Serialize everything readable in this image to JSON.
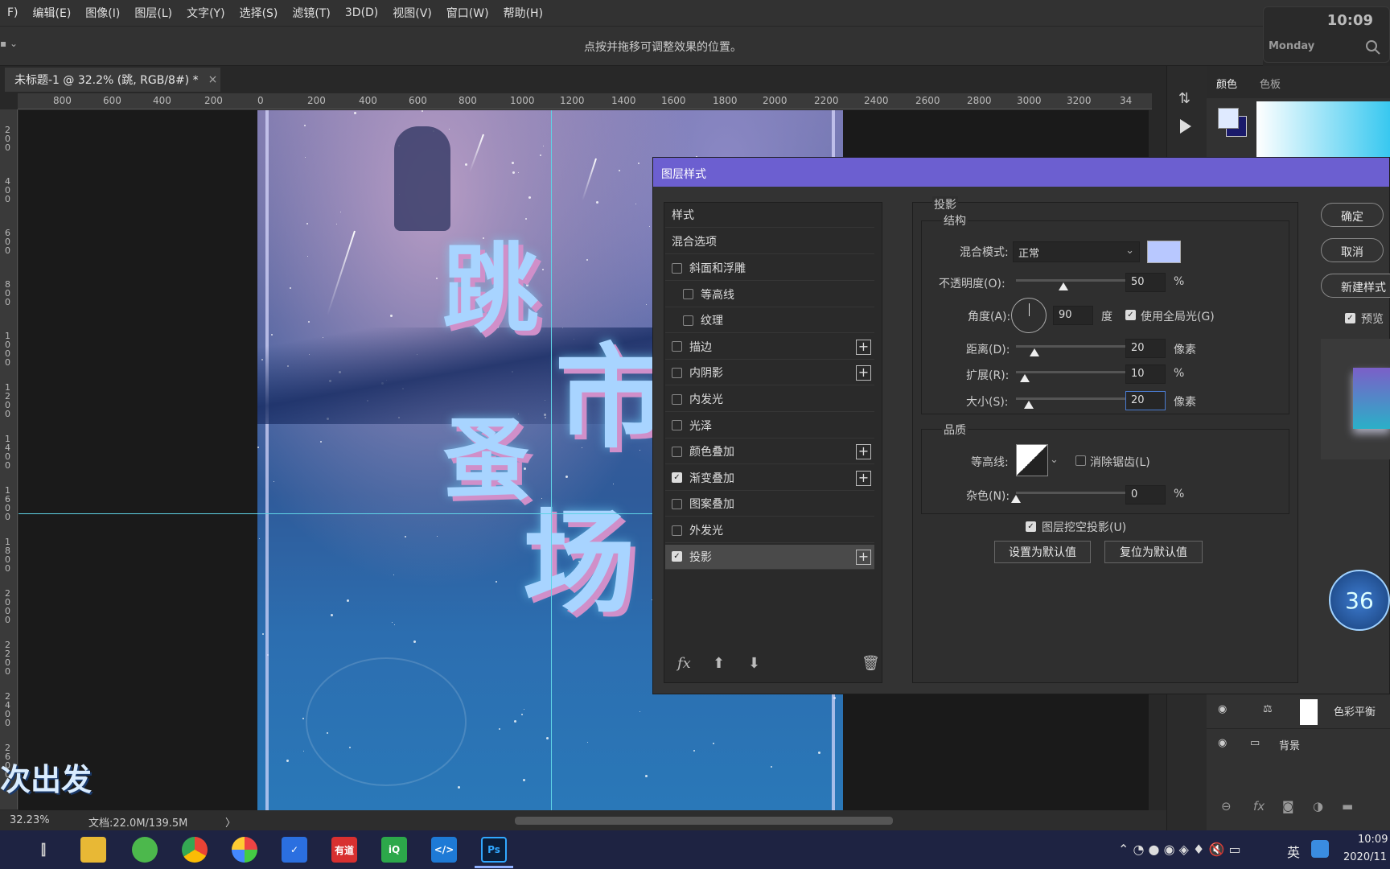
{
  "menu": [
    "F)",
    "编辑(E)",
    "图像(I)",
    "图层(L)",
    "文字(Y)",
    "选择(S)",
    "滤镜(T)",
    "3D(D)",
    "视图(V)",
    "窗口(W)",
    "帮助(H)"
  ],
  "options_hint": "点按并拖移可调整效果的位置。",
  "clock": {
    "time": "10:09",
    "day": "Monday"
  },
  "doc_tab": {
    "title": "未标题-1 @ 32.2% (跳, RGB/8#) *",
    "close": "×"
  },
  "ruler_h": [
    "800",
    "600",
    "400",
    "200",
    "0",
    "200",
    "400",
    "600",
    "800",
    "1000",
    "1200",
    "1400",
    "1600",
    "1800",
    "2000",
    "2200",
    "2400",
    "2600",
    "2800",
    "3000",
    "3200",
    "34"
  ],
  "ruler_v": [
    "2\n0\n0",
    "4\n0\n0",
    "6\n0\n0",
    "8\n0\n0",
    "1\n0\n0\n0",
    "1\n2\n0\n0",
    "1\n4\n0\n0",
    "1\n6\n0\n0",
    "1\n8\n0\n0",
    "2\n0\n0\n0",
    "2\n2\n0\n0",
    "2\n4\n0\n0",
    "2\n6\n0\n0"
  ],
  "artwork": {
    "chars": [
      "跳",
      "市",
      "蚤",
      "场"
    ]
  },
  "subtitle": "次出发",
  "status": {
    "zoom": "32.23%",
    "doc": "文档:22.0M/139.5M",
    "arrow": "〉"
  },
  "panel": {
    "tab_color": "颜色",
    "tab_swatch": "色板",
    "layer1": "色彩平衡",
    "layer2": "背景"
  },
  "dialog": {
    "title": "图层样式",
    "styles_header": "样式",
    "blend_options": "混合选项",
    "items": [
      {
        "label": "斜面和浮雕",
        "checked": false,
        "plus": false,
        "indent": false
      },
      {
        "label": "等高线",
        "checked": false,
        "plus": false,
        "indent": true
      },
      {
        "label": "纹理",
        "checked": false,
        "plus": false,
        "indent": true
      },
      {
        "label": "描边",
        "checked": false,
        "plus": true,
        "indent": false
      },
      {
        "label": "内阴影",
        "checked": false,
        "plus": true,
        "indent": false
      },
      {
        "label": "内发光",
        "checked": false,
        "plus": false,
        "indent": false
      },
      {
        "label": "光泽",
        "checked": false,
        "plus": false,
        "indent": false
      },
      {
        "label": "颜色叠加",
        "checked": false,
        "plus": true,
        "indent": false
      },
      {
        "label": "渐变叠加",
        "checked": true,
        "plus": true,
        "indent": false
      },
      {
        "label": "图案叠加",
        "checked": false,
        "plus": false,
        "indent": false
      },
      {
        "label": "外发光",
        "checked": false,
        "plus": false,
        "indent": false
      },
      {
        "label": "投影",
        "checked": true,
        "plus": true,
        "indent": false,
        "selected": true
      }
    ],
    "section_title": "投影",
    "structure": "结构",
    "blend_mode_label": "混合模式:",
    "blend_mode_value": "正常",
    "shadow_color": "#b8c8ff",
    "opacity_label": "不透明度(O):",
    "opacity_value": "50",
    "pct": "%",
    "angle_label": "角度(A):",
    "angle_value": "90",
    "degree": "度",
    "global_light": "使用全局光(G)",
    "distance_label": "距离(D):",
    "distance_value": "20",
    "px": "像素",
    "spread_label": "扩展(R):",
    "spread_value": "10",
    "size_label": "大小(S):",
    "size_value": "20",
    "quality": "品质",
    "contour_label": "等高线:",
    "antialias": "消除锯齿(L)",
    "noise_label": "杂色(N):",
    "noise_value": "0",
    "knockout": "图层挖空投影(U)",
    "set_default": "设置为默认值",
    "reset_default": "复位为默认值",
    "ok": "确定",
    "cancel": "取消",
    "new_style": "新建样式",
    "preview": "预览",
    "fx": "fx"
  },
  "taskbar": {
    "time": "10:09",
    "date": "2020/11",
    "ime": "英"
  }
}
